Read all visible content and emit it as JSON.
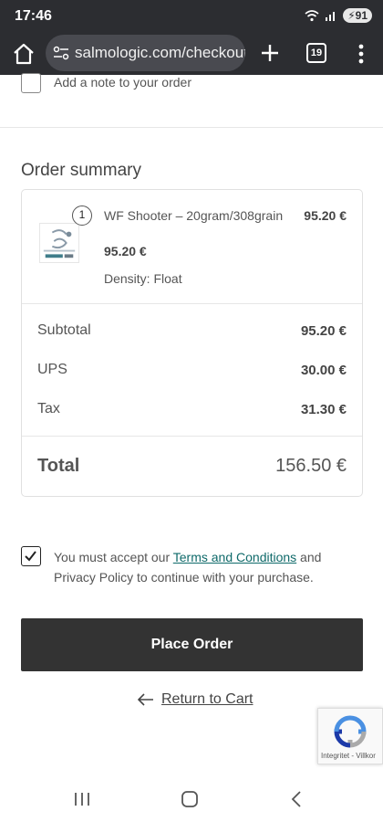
{
  "status_bar": {
    "time": "17:46",
    "battery": "91"
  },
  "browser": {
    "url": "salmologic.com/checkout",
    "tab_count": "19"
  },
  "note": {
    "label": "Add a note to your order"
  },
  "order_summary": {
    "title": "Order summary",
    "item": {
      "quantity": "1",
      "name": "WF Shooter – 20gram/308grain",
      "price": "95.20 €",
      "line_price": "95.20 €",
      "meta": "Density: Float"
    },
    "rows": [
      {
        "label": "Subtotal",
        "value": "95.20 €"
      },
      {
        "label": "UPS",
        "value": "30.00 €"
      },
      {
        "label": "Tax",
        "value": "31.30 €"
      }
    ],
    "total": {
      "label": "Total",
      "value": "156.50 €"
    }
  },
  "terms": {
    "prefix": "You must accept our ",
    "link": "Terms and Conditions",
    "suffix": " and Privacy Policy to continue with your purchase."
  },
  "place_order": {
    "label": "Place Order"
  },
  "return_to_cart": {
    "label": "Return to Cart"
  },
  "recaptcha": {
    "text": "Integritet - Villkor"
  },
  "colors": {
    "chrome_dark": "#2c2d31",
    "button": "#333333",
    "link": "#0f6a6a"
  }
}
